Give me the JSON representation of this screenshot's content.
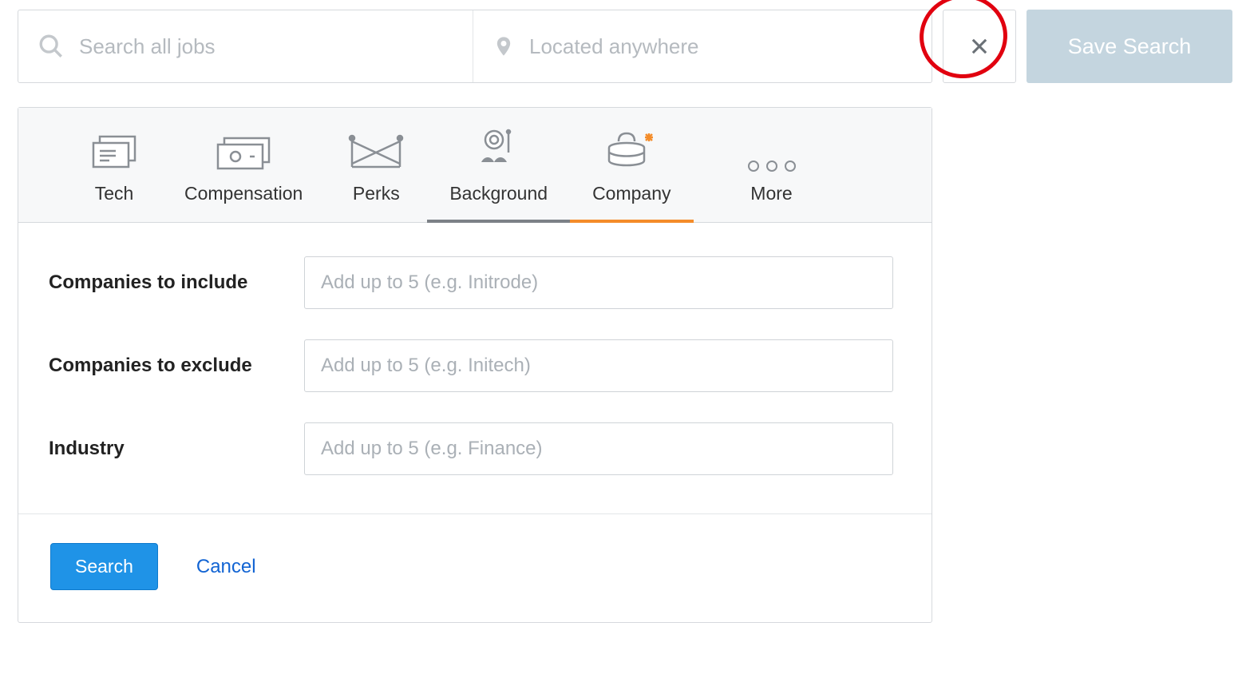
{
  "searchbar": {
    "job_placeholder": "Search all jobs",
    "location_placeholder": "Located anywhere",
    "save_label": "Save Search"
  },
  "tabs": {
    "tech": "Tech",
    "compensation": "Compensation",
    "perks": "Perks",
    "background": "Background",
    "company": "Company",
    "more": "More"
  },
  "filters": {
    "include_label": "Companies to include",
    "include_placeholder": "Add up to 5 (e.g. Initrode)",
    "exclude_label": "Companies to exclude",
    "exclude_placeholder": "Add up to 5 (e.g. Initech)",
    "industry_label": "Industry",
    "industry_placeholder": "Add up to 5 (e.g. Finance)"
  },
  "actions": {
    "search": "Search",
    "cancel": "Cancel"
  }
}
